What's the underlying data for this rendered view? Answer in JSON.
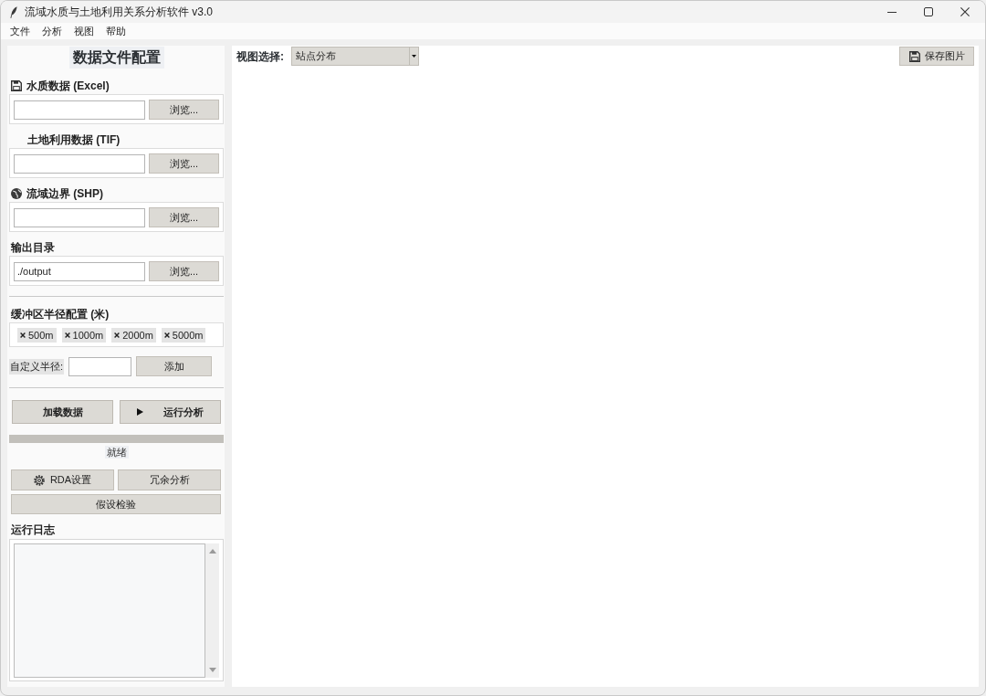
{
  "window": {
    "title": "流域水质与土地利用关系分析软件 v3.0"
  },
  "menu": [
    {
      "label": "文件"
    },
    {
      "label": "分析"
    },
    {
      "label": "视图"
    },
    {
      "label": "帮助"
    }
  ],
  "config_panel": {
    "title": "数据文件配置",
    "file_inputs": [
      {
        "kind": "excel",
        "label": "水质数据 (Excel)",
        "button": "浏览..."
      },
      {
        "kind": "tif",
        "label": "土地利用数据 (TIF)",
        "button": "浏览..."
      },
      {
        "kind": "shp",
        "label": "流域边界 (SHP)",
        "button": "浏览..."
      },
      {
        "kind": "folder",
        "label": "输出目录",
        "value": "./output",
        "button": "浏览..."
      }
    ],
    "buffer": {
      "label": "缓冲区半径配置 (米)",
      "radii": [
        "500m",
        "1000m",
        "2000m",
        "5000m"
      ]
    },
    "custom_radius": {
      "label": "自定义半径:",
      "button": "添加"
    },
    "actions": [
      {
        "kind": "load",
        "label": "加载数据"
      },
      {
        "kind": "run",
        "label": "运行分析"
      }
    ],
    "progress": {
      "level": 0
    },
    "status": "就绪",
    "tools": [
      {
        "kind": "settings",
        "label": "RDA设置"
      },
      {
        "kind": "plain",
        "label": "冗余分析"
      },
      {
        "kind": "plain",
        "label": "假设检验"
      }
    ],
    "log": {
      "title": "运行日志"
    }
  },
  "view_panel": {
    "label": "视图选择:",
    "view_select": {
      "value": "站点分布"
    },
    "save_button": "保存图片"
  }
}
